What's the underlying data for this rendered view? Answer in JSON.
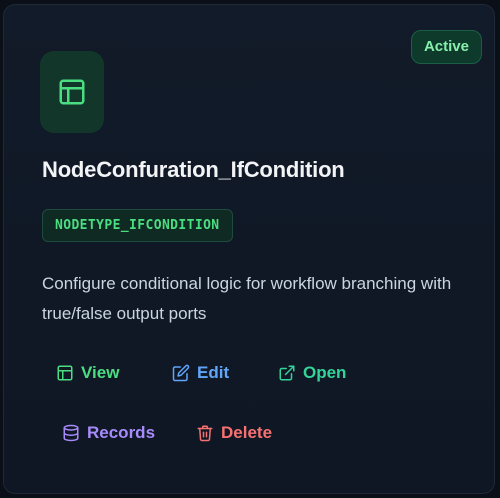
{
  "card": {
    "status": "Active",
    "title": "NodeConfuration_IfCondition",
    "type_code": "NODETYPE_IFCONDITION",
    "description": "Configure conditional logic for workflow branching with true/false output ports",
    "icon": "layout-icon"
  },
  "actions": {
    "view": {
      "label": "View",
      "icon": "layout-icon",
      "color": "#4ade80"
    },
    "edit": {
      "label": "Edit",
      "icon": "edit-icon",
      "color": "#60a5fa"
    },
    "open": {
      "label": "Open",
      "icon": "external-link-icon",
      "color": "#34d399"
    },
    "records": {
      "label": "Records",
      "icon": "database-icon",
      "color": "#a78bfa"
    },
    "delete": {
      "label": "Delete",
      "icon": "trash-icon",
      "color": "#f87171"
    }
  },
  "colors": {
    "accent_green": "#4ade80",
    "badge_text": "#86efac",
    "background": "#0b0f17"
  }
}
